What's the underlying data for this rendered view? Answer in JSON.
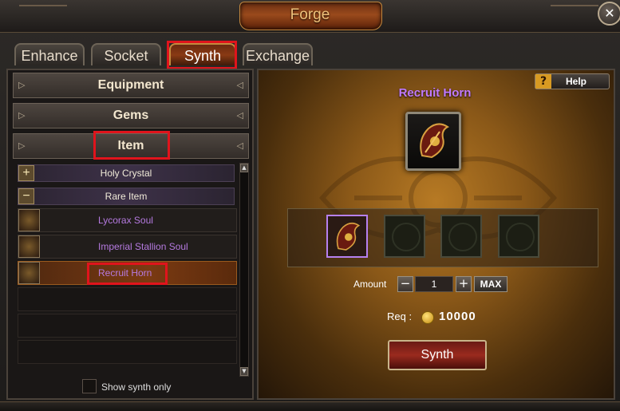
{
  "window": {
    "title": "Forge",
    "close_glyph": "✕"
  },
  "tabs": [
    {
      "label": "Enhance",
      "active": false
    },
    {
      "label": "Socket",
      "active": false
    },
    {
      "label": "Synth",
      "active": true
    },
    {
      "label": "Exchange",
      "active": false
    }
  ],
  "categories": [
    {
      "label": "Equipment"
    },
    {
      "label": "Gems"
    },
    {
      "label": "Item"
    }
  ],
  "subcategories": [
    {
      "label": "Holy Crystal",
      "toggle": "+"
    },
    {
      "label": "Rare Item",
      "toggle": "−"
    }
  ],
  "items": [
    {
      "label": "Lycorax Soul",
      "selected": false
    },
    {
      "label": "Imperial Stallion Soul",
      "selected": false
    },
    {
      "label": "Recruit Horn",
      "selected": true
    }
  ],
  "filter": {
    "show_synth_only_label": "Show synth only",
    "checked": false
  },
  "help": {
    "icon": "?",
    "label": "Help"
  },
  "result": {
    "name": "Recruit Horn"
  },
  "materials": {
    "filled_slots": 1,
    "total_slots": 4
  },
  "amount": {
    "label": "Amount",
    "minus": "−",
    "plus": "+",
    "value": "1",
    "max_label": "MAX"
  },
  "requirement": {
    "label": "Req :",
    "value": "10000",
    "currency_icon": "coin-icon"
  },
  "synth_button": {
    "label": "Synth"
  },
  "colors": {
    "accent_purple": "#c07aff",
    "highlight_red": "#e0141c",
    "gold": "#d89a22"
  }
}
